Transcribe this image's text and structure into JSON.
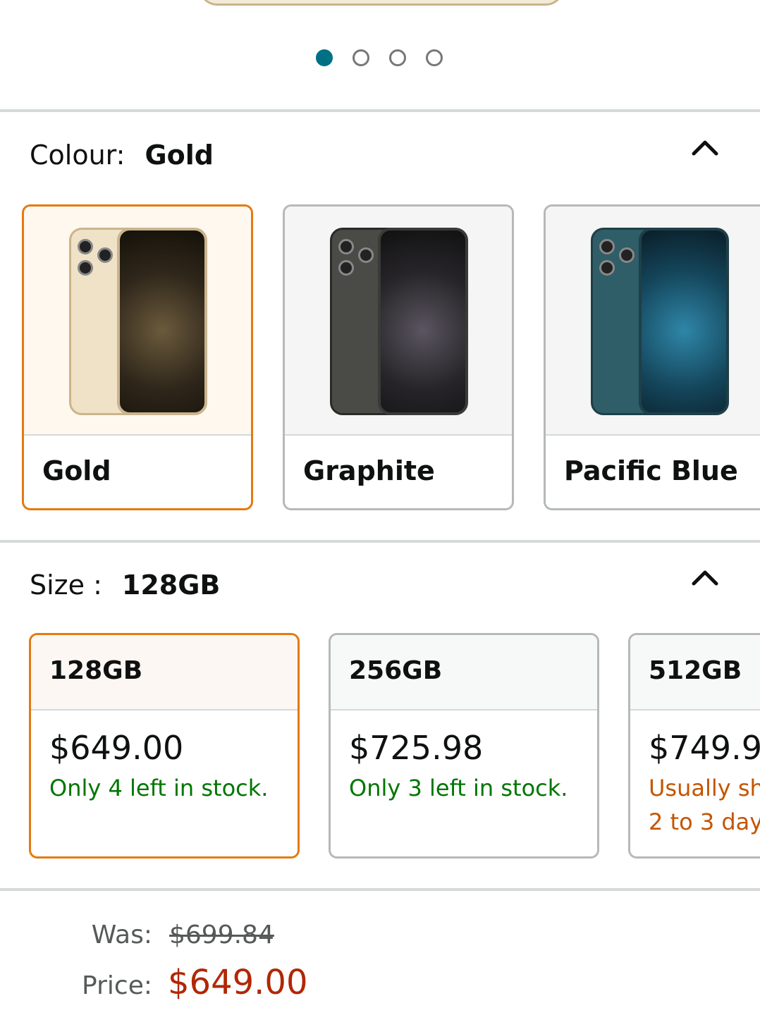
{
  "colors": {
    "accent": "#007185",
    "selected_border": "#e47911",
    "price_red": "#b12704",
    "stock_green": "#007600",
    "stock_orange": "#c45500"
  },
  "carousel": {
    "total_dots": 4,
    "active_index": 0
  },
  "colour_section": {
    "label": "Colour:",
    "value": "Gold",
    "collapse_icon": "chevron-up-icon",
    "options": [
      {
        "name": "Gold",
        "selected": true
      },
      {
        "name": "Graphite",
        "selected": false
      },
      {
        "name": "Pacific Blue",
        "selected": false
      }
    ]
  },
  "size_section": {
    "label": "Size :",
    "value": "128GB",
    "collapse_icon": "chevron-up-icon",
    "options": [
      {
        "size": "128GB",
        "price": "$649.00",
        "stock": "Only 4 left in stock.",
        "stock2": "",
        "selected": true
      },
      {
        "size": "256GB",
        "price": "$725.98",
        "stock": "Only 3 left in stock.",
        "stock2": "",
        "selected": false
      },
      {
        "size": "512GB",
        "price": "$749.9",
        "stock": "Usually sh",
        "stock2": "2 to 3 day",
        "selected": false
      }
    ]
  },
  "pricing": {
    "was_label": "Was:",
    "was_value": "$699.84",
    "price_label": "Price:",
    "price_value": "$649.00"
  }
}
